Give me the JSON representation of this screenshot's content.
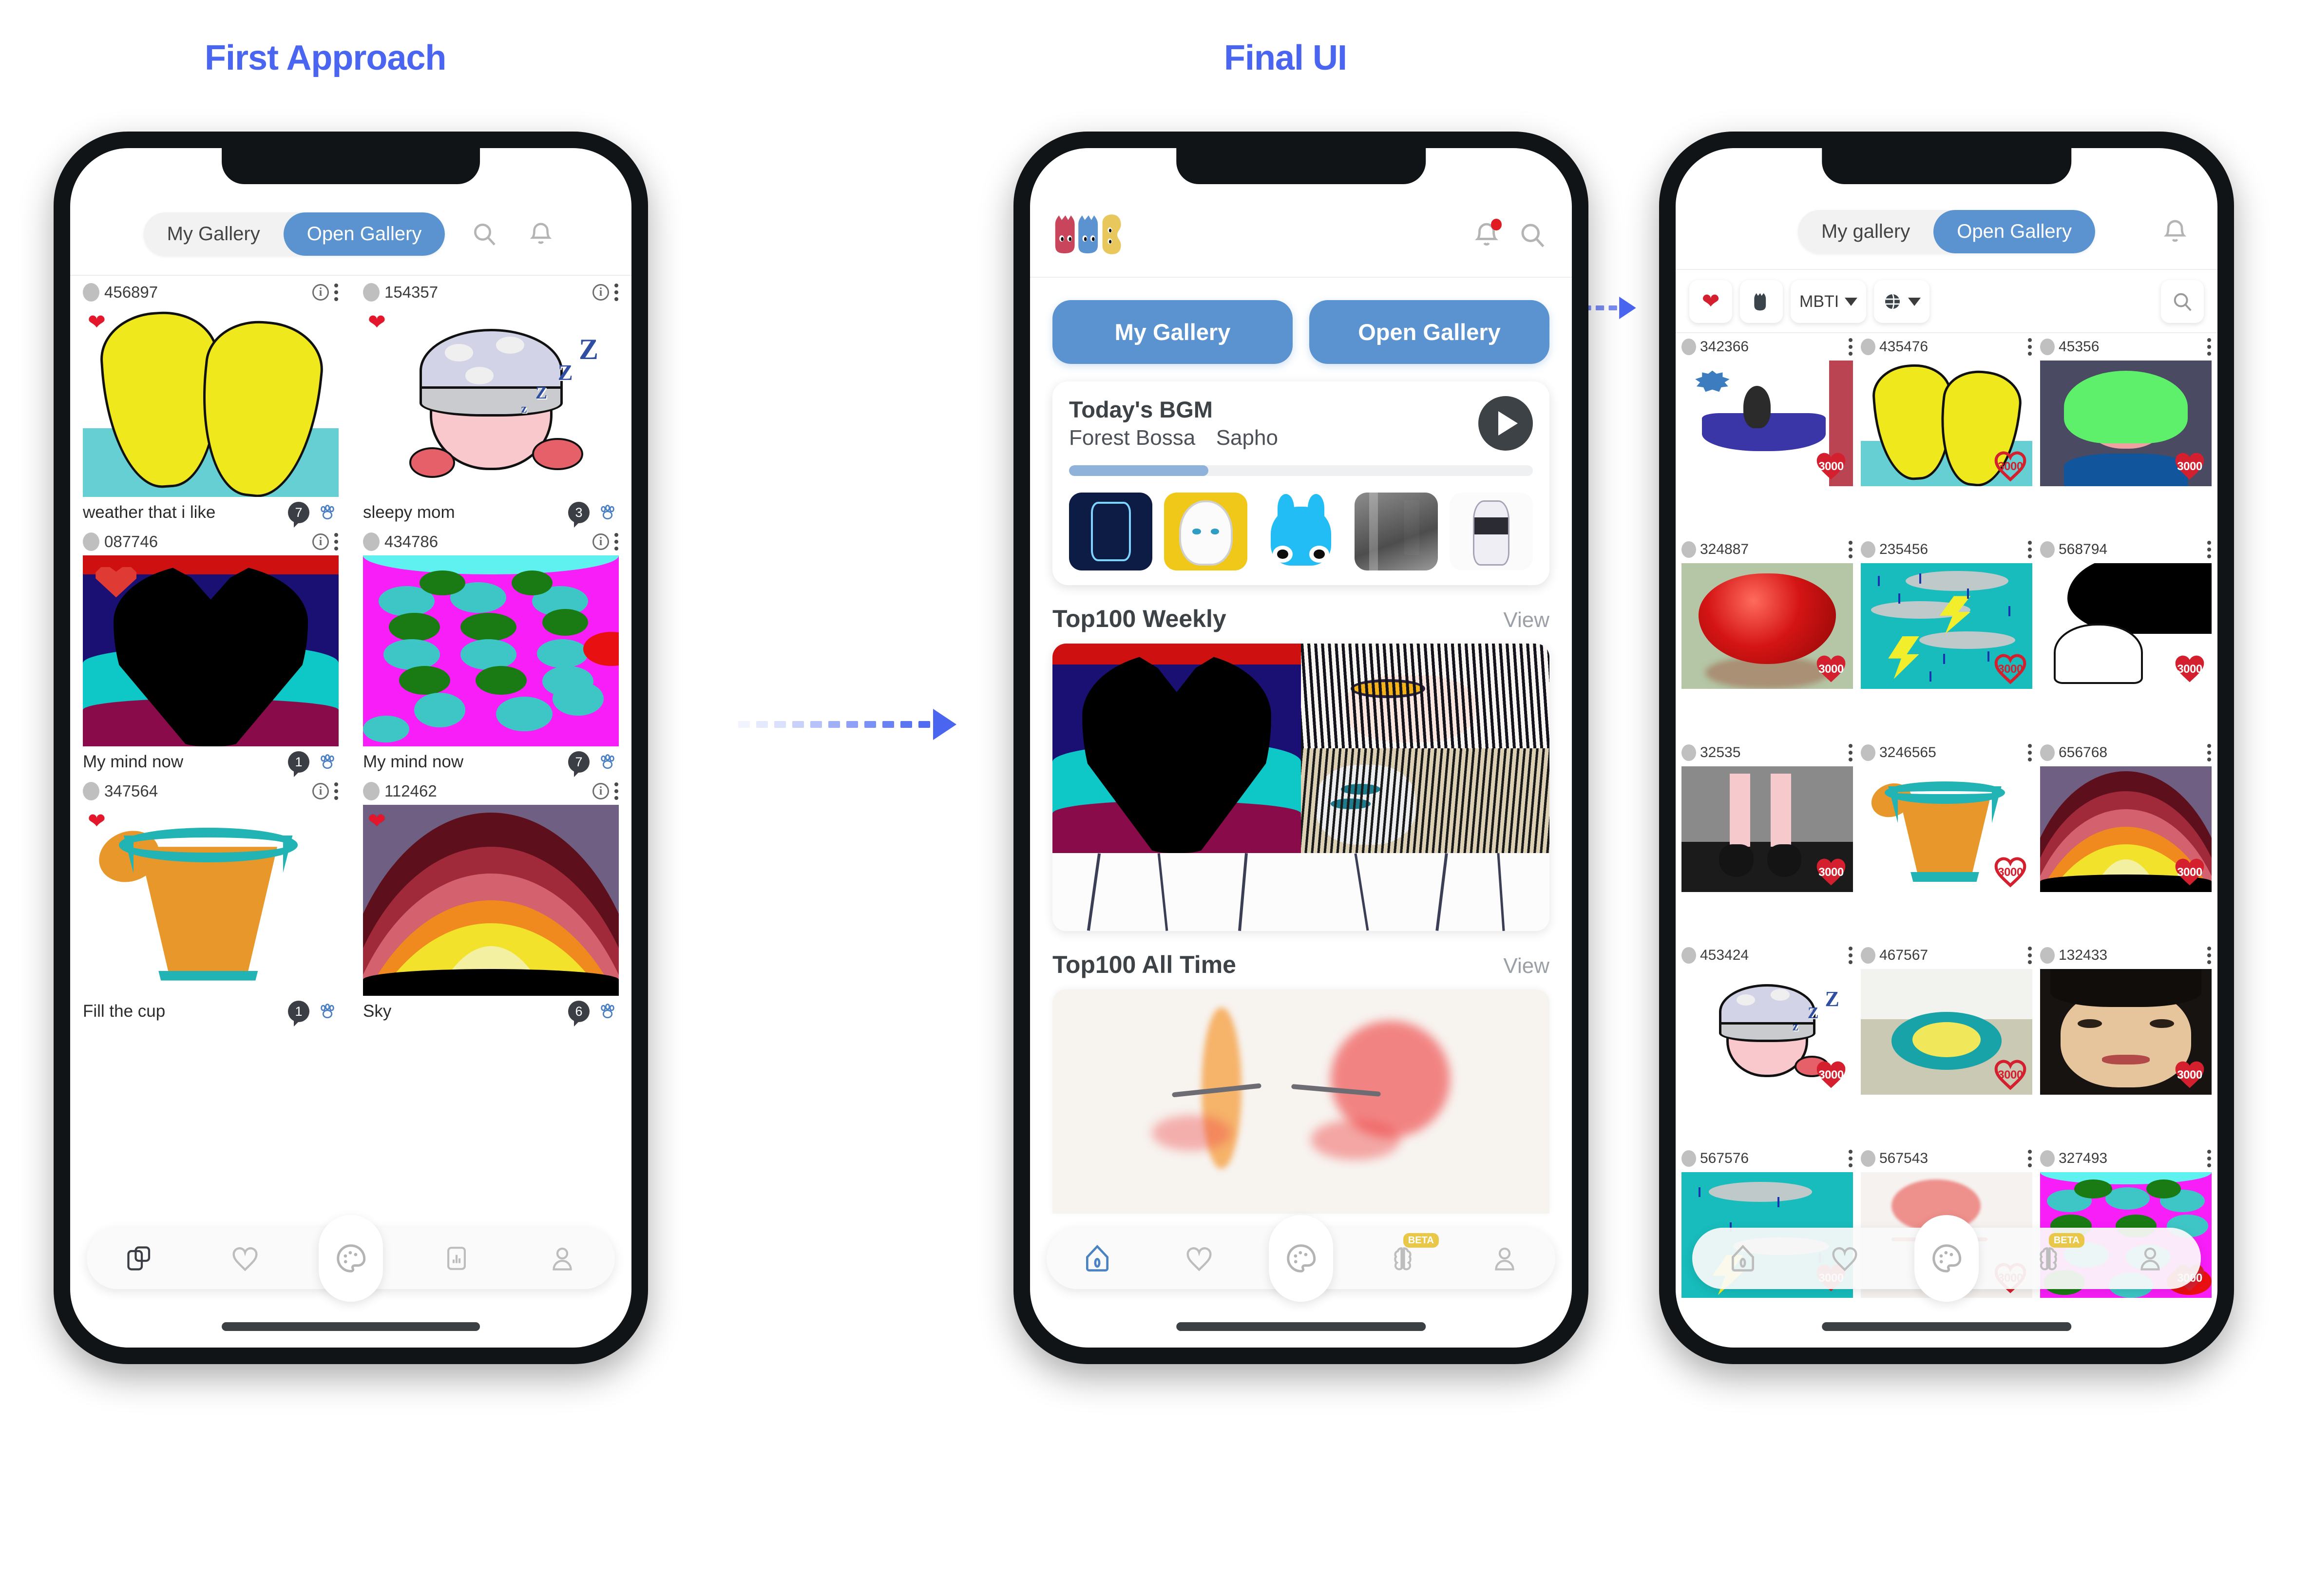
{
  "sections": {
    "first_approach_title": "First Approach",
    "final_ui_title": "Final UI"
  },
  "phone1": {
    "tabs": {
      "my_gallery": "My Gallery",
      "open_gallery": "Open Gallery",
      "active": "Open Gallery"
    },
    "header_icons": [
      "search-icon",
      "bell-icon"
    ],
    "cards": [
      {
        "uid": "456897",
        "title": "weather that i like",
        "comments": "7",
        "liked": true
      },
      {
        "uid": "154357",
        "title": "sleepy mom",
        "comments": "3",
        "liked": true
      },
      {
        "uid": "087746",
        "title": "My mind now",
        "comments": "1",
        "liked": true
      },
      {
        "uid": "434786",
        "title": "My mind now",
        "comments": "7",
        "liked": true
      },
      {
        "uid": "347564",
        "title": "Fill the cup",
        "comments": "1",
        "liked": true
      },
      {
        "uid": "112462",
        "title": "Sky",
        "comments": "6",
        "liked": true
      }
    ],
    "nav": [
      "copy-icon",
      "heart-icon",
      "palette-icon",
      "chart-icon",
      "person-icon"
    ]
  },
  "phone2": {
    "logo": "three-cats-logo",
    "header_icons": [
      "bell-icon-with-dot",
      "search-icon"
    ],
    "tabs": {
      "my_gallery": "My Gallery",
      "open_gallery": "Open Gallery"
    },
    "bgm": {
      "label": "Today's BGM",
      "track": "Forest Bossa",
      "artist": "Sapho",
      "progress_percent": 30,
      "play_button": "play-icon",
      "thumbnails": [
        "sci-sketch",
        "gold-creature",
        "blue-bunny",
        "gray-photo",
        "white-figure"
      ]
    },
    "top_weekly": {
      "heading": "Top100 Weekly",
      "view": "View"
    },
    "top_alltime": {
      "heading": "Top100 All Time",
      "view": "View"
    },
    "nav": [
      "home-icon",
      "heart-icon",
      "palette-icon",
      "brain-icon",
      "person-icon"
    ],
    "nav_badge": "BETA",
    "nav_active": "home-icon"
  },
  "phone3": {
    "tabs": {
      "my_gallery": "My gallery",
      "open_gallery": "Open Gallery",
      "active": "Open Gallery"
    },
    "header_icons": [
      "bell-icon"
    ],
    "filters": [
      {
        "name": "heart-filter",
        "icon": "heart-icon"
      },
      {
        "name": "cat-filter",
        "icon": "cat-icon"
      },
      {
        "name": "mbti-filter",
        "label": "MBTI",
        "caret": true
      },
      {
        "name": "globe-filter",
        "icon": "globe-icon",
        "caret": true
      }
    ],
    "search_icon": "search-icon",
    "cards": [
      {
        "uid": "342366",
        "likes": "3000",
        "hollow": false
      },
      {
        "uid": "435476",
        "likes": "3000",
        "hollow": true
      },
      {
        "uid": "45356",
        "likes": "3000",
        "hollow": false
      },
      {
        "uid": "324887",
        "likes": "3000",
        "hollow": false
      },
      {
        "uid": "235456",
        "likes": "3000",
        "hollow": true
      },
      {
        "uid": "568794",
        "likes": "3000",
        "hollow": false
      },
      {
        "uid": "32535",
        "likes": "3000",
        "hollow": false
      },
      {
        "uid": "3246565",
        "likes": "3000",
        "hollow": true
      },
      {
        "uid": "656768",
        "likes": "3000",
        "hollow": false
      },
      {
        "uid": "453424",
        "likes": "3000",
        "hollow": false
      },
      {
        "uid": "467567",
        "likes": "3000",
        "hollow": true
      },
      {
        "uid": "132433",
        "likes": "3000",
        "hollow": false
      },
      {
        "uid": "567576",
        "likes": "3000",
        "hollow": false
      },
      {
        "uid": "567543",
        "likes": "3000",
        "hollow": true
      },
      {
        "uid": "327493",
        "likes": "3000",
        "hollow": false
      }
    ],
    "nav": [
      "home-icon",
      "heart-icon",
      "palette-icon",
      "brain-icon",
      "person-icon"
    ],
    "nav_badge": "BETA"
  },
  "colors": {
    "accent_blue": "#4a66f0",
    "tab_blue": "#5b93d0",
    "heart_red": "#e4162b",
    "badge_yellow": "#e9c849"
  }
}
